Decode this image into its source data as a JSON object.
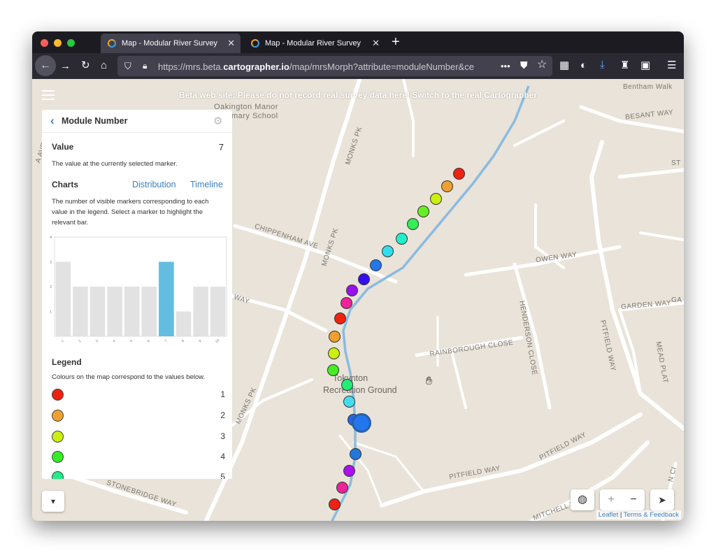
{
  "browser": {
    "tabs": [
      {
        "title": "Map - Modular River Survey",
        "active": true
      },
      {
        "title": "Map - Modular River Survey",
        "active": false
      }
    ],
    "url_prefix": "https://mrs.beta.",
    "url_domain": "cartographer.io",
    "url_suffix": "/map/mrsMorph?attribute=moduleNumber&ce",
    "icons": [
      "back-icon",
      "forward-icon",
      "reload-icon",
      "home-icon",
      "shield-icon",
      "lock-icon",
      "more-icon",
      "pocket-icon",
      "star-icon",
      "extensions-icon",
      "download-icon",
      "menu-icon"
    ]
  },
  "map": {
    "banner_prefix": "Beta web site: Please do not record real survey data here!",
    "banner_link": "Switch to the real Cartographer",
    "labels": {
      "oakington": "Oakington Manor",
      "primary": "Primary School",
      "bentham": "Bentham Walk",
      "besant": "BESANT WAY",
      "owen": "OWEN WAY",
      "garden": "GARDEN WAY",
      "ga": "GA",
      "henderson": "HENDERSON CLOSE",
      "pitfield1": "PITFIELD WAY",
      "pitfield2": "PITFIELD WAY",
      "pitfield3": "PITFIELD WAY",
      "mead": "MEAD PLAT",
      "rainborough": "RAINBOROUGH CLOSE",
      "chippenham": "CHIPPENHAM AVE",
      "monks1": "MONKS PK",
      "monks2": "MONKS PK",
      "monks3": "MONKS PK",
      "stonebridge": "STONEBRIDGE WAY",
      "mitchell": "MITCHELL W",
      "way": "WAY",
      "ave": "A AVE",
      "st": "ST",
      "nci": "N CI",
      "park1": "Tokynton",
      "park2": "Recreation Ground"
    },
    "controls": {
      "zoom_in": "+",
      "zoom_out": "−"
    },
    "attribution_leaflet": "Leaflet",
    "attribution_sep": "|",
    "attribution_terms": "Terms & Feedback"
  },
  "panel": {
    "title": "Module Number",
    "value_heading": "Value",
    "value": "7",
    "value_desc": "The value at the currently selected marker.",
    "charts_heading": "Charts",
    "chart_tabs": [
      "Distribution",
      "Timeline"
    ],
    "charts_desc": "The number of visible markers corresponding to each value in the legend. Select a marker to highlight the relevant bar.",
    "legend_heading": "Legend",
    "legend_desc": "Colours on the map correspond to the values below.",
    "legend": [
      {
        "value": "1",
        "color": "#ee2211"
      },
      {
        "value": "2",
        "color": "#f0a030"
      },
      {
        "value": "3",
        "color": "#ccee11"
      },
      {
        "value": "4",
        "color": "#33ee22"
      },
      {
        "value": "5",
        "color": "#22ee88"
      }
    ]
  },
  "chart_data": {
    "type": "bar",
    "categories": [
      "1",
      "2",
      "3",
      "4",
      "5",
      "6",
      "7",
      "8",
      "9",
      "10"
    ],
    "values": [
      3,
      2,
      2,
      2,
      2,
      2,
      3,
      1,
      2,
      2
    ],
    "highlight_category": "7",
    "y_ticks": [
      1,
      2,
      3,
      4
    ],
    "ylim": [
      0,
      4
    ],
    "bar_color": "#e2e2e2",
    "highlight_color": "#62bde0",
    "grid": false
  },
  "markers": {
    "colors": [
      "#ee2211",
      "#f0a030",
      "#ccee11",
      "#66ee22",
      "#33ee55",
      "#22eecc",
      "#33ddee",
      "#2277ee",
      "#3311ee",
      "#9911ee",
      "#ee2299",
      "#ee2211",
      "#f0a030",
      "#ccee11",
      "#44ee22",
      "#22ee77",
      "#44ddee",
      "#2266ee",
      "#2277dd",
      "#aa11ee",
      "#ee2299",
      "#ee2211"
    ],
    "selected_color": "#2277ee"
  }
}
